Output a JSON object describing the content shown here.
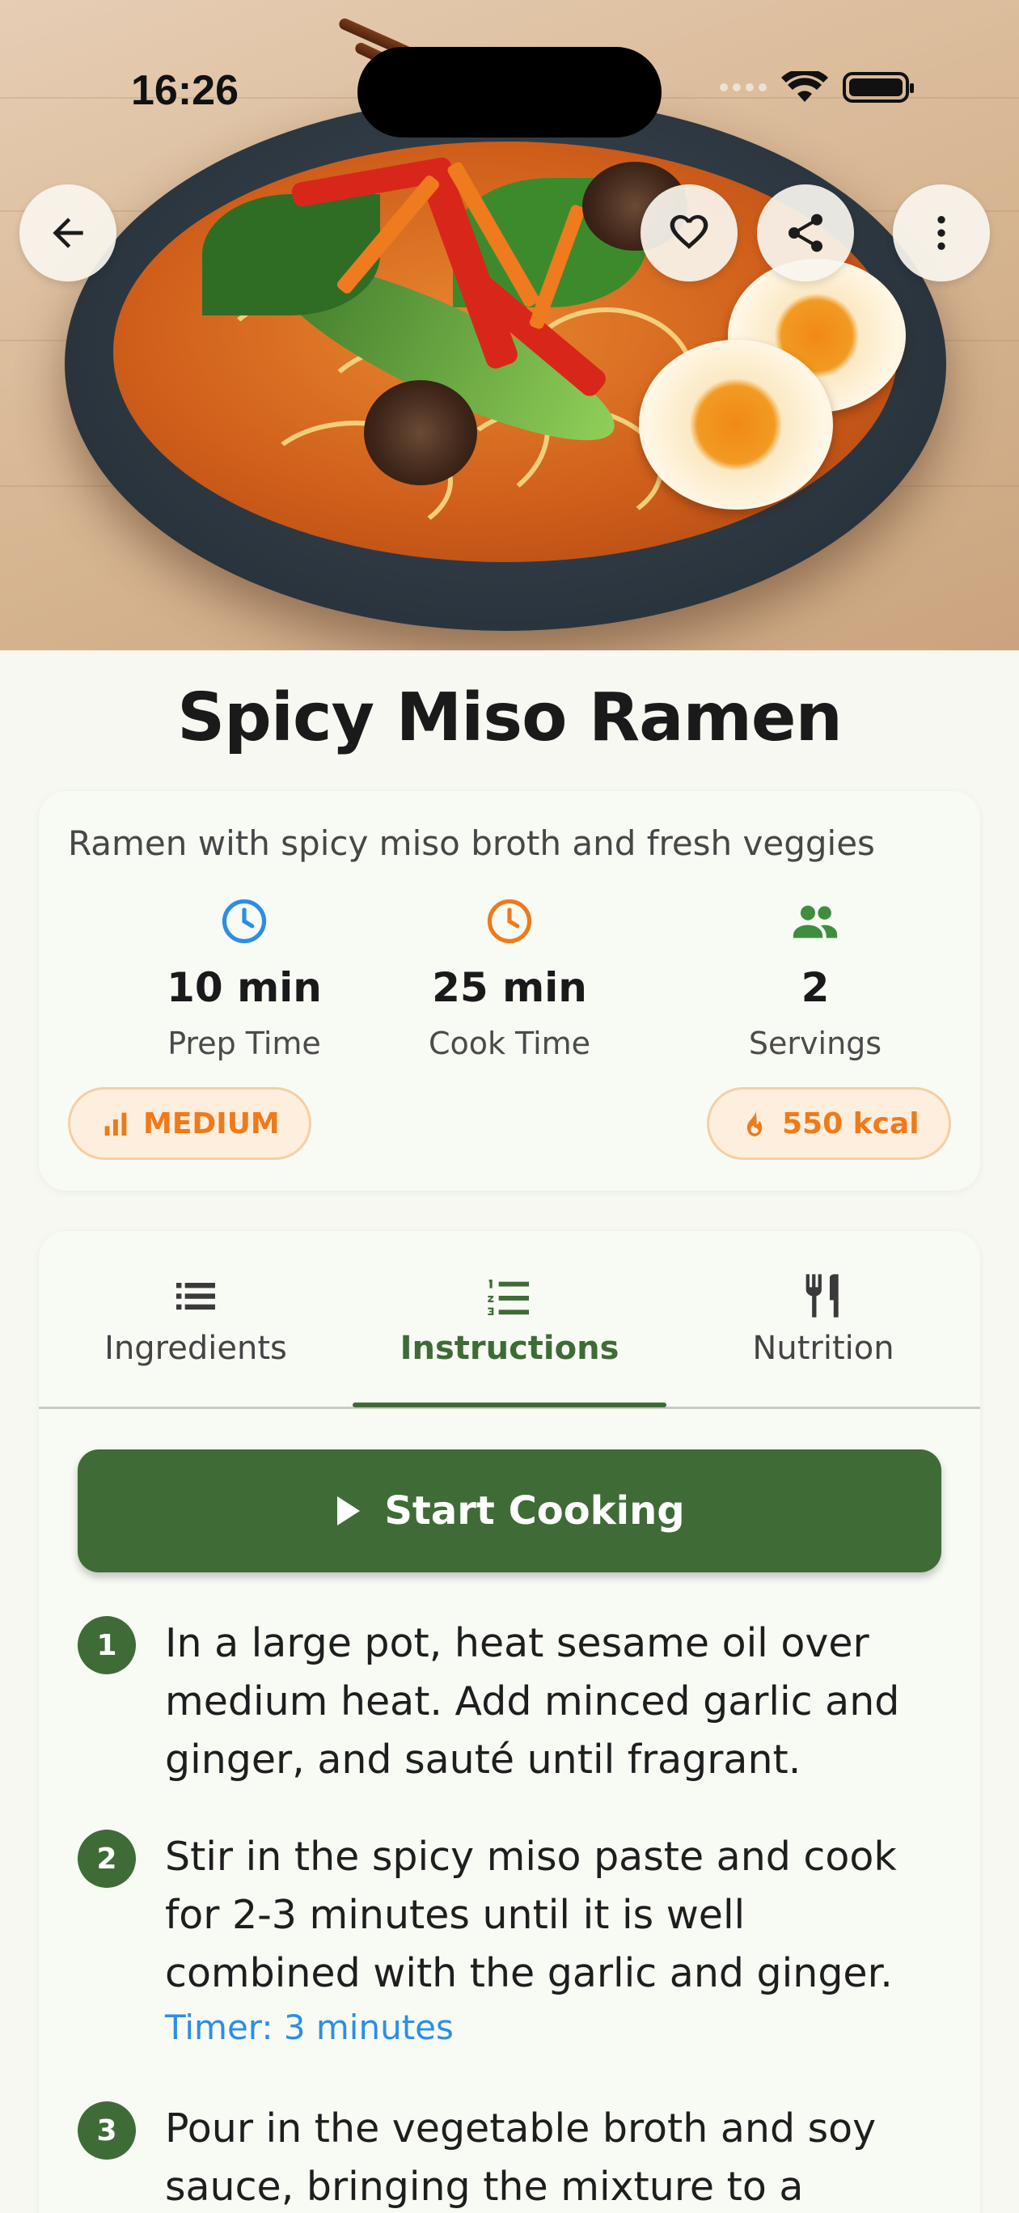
{
  "status_bar": {
    "time": "16:26"
  },
  "hero": {
    "image_description_icon": "ramen-bowl-photo"
  },
  "top_actions": {
    "back_icon": "arrow-left-icon",
    "favorite_icon": "heart-icon",
    "share_icon": "share-icon",
    "more_icon": "more-vertical-icon"
  },
  "recipe": {
    "title": "Spicy Miso Ramen",
    "description": "Ramen with spicy miso broth and fresh veggies",
    "stats": [
      {
        "value": "10 min",
        "label": "Prep Time",
        "icon": "clock-icon",
        "color": "#2b8ee6"
      },
      {
        "value": "25 min",
        "label": "Cook Time",
        "icon": "clock-icon",
        "color": "#ee7a1a"
      },
      {
        "value": "2",
        "label": "Servings",
        "icon": "people-icon",
        "color": "#3e8e3e"
      }
    ],
    "difficulty": "MEDIUM",
    "calories": "550 kcal"
  },
  "tabs": [
    {
      "label": "Ingredients",
      "icon": "list-icon",
      "active": false
    },
    {
      "label": "Instructions",
      "icon": "numbered-list-icon",
      "active": true
    },
    {
      "label": "Nutrition",
      "icon": "cutlery-icon",
      "active": false
    }
  ],
  "start_button": {
    "label": "Start Cooking",
    "icon": "play-icon"
  },
  "steps": [
    {
      "number": "1",
      "text": "In a large pot, heat sesame oil over medium heat. Add minced garlic and ginger, and sauté until fragrant."
    },
    {
      "number": "2",
      "text": "Stir in the spicy miso paste and cook for 2-3 minutes until it is well combined with the garlic and ginger.",
      "timer": "Timer: 3 minutes"
    },
    {
      "number": "3",
      "text": "Pour in the vegetable broth and soy sauce, bringing the mixture to a"
    }
  ],
  "colors": {
    "primary_green": "#3f6b37",
    "accent_orange": "#ee7a1a",
    "timer_blue": "#2b8ee6",
    "background": "#f6f8f1"
  }
}
